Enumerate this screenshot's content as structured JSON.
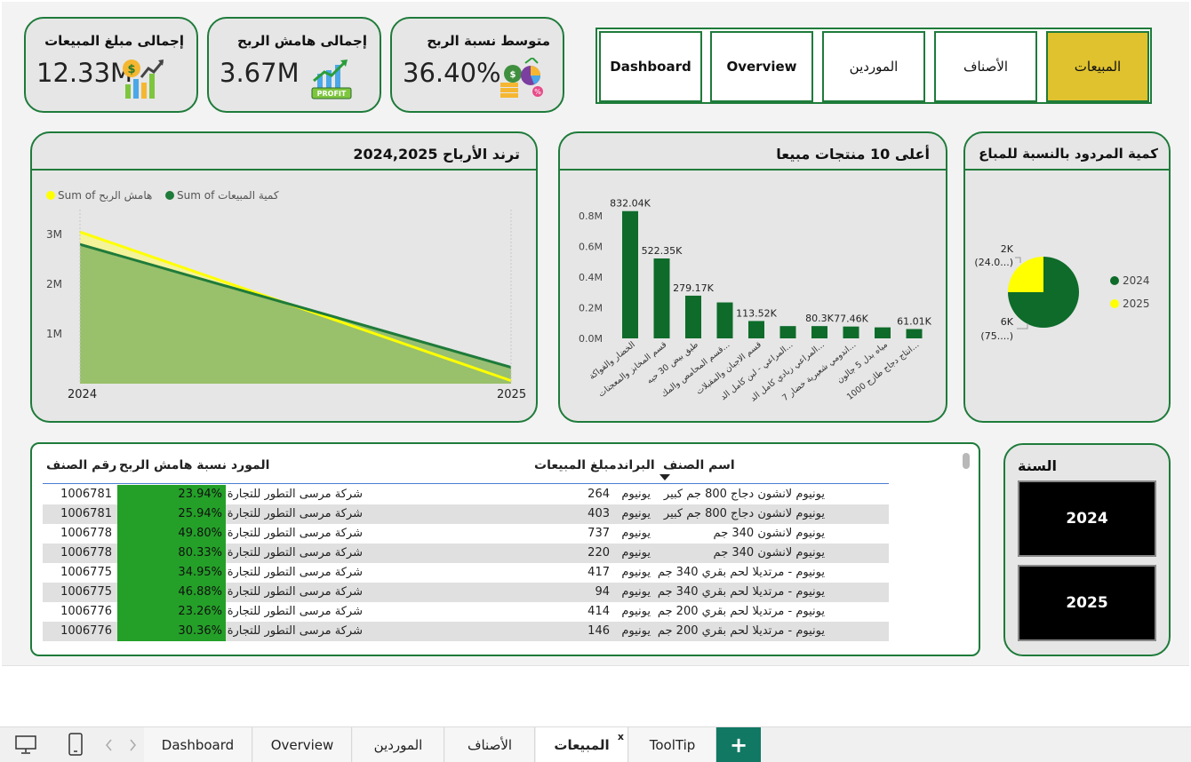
{
  "kpis": [
    {
      "title": "إجمالى مبلغ المبيعات",
      "value": "12.33M",
      "icon": "money-growth-icon"
    },
    {
      "title": "إجمالى هامش الربح",
      "value": "3.67M",
      "icon": "profit-growth-icon"
    },
    {
      "title": "متوسط نسبة الربح",
      "value": "36.40%",
      "icon": "money-bag-pie-icon"
    }
  ],
  "nav": [
    "Dashboard",
    "Overview",
    "الموردين",
    "الأصناف",
    "المبيعات"
  ],
  "nav_active": "المبيعات",
  "trend_panel": {
    "title": "ترند الأرباح 2024,2025"
  },
  "top10_panel": {
    "title": "أعلى 10 منتجات مبيعا"
  },
  "returns_panel": {
    "title": "كمية المردود بالنسبة للمباع"
  },
  "year_panel": {
    "title": "السنة",
    "years": [
      "2024",
      "2025"
    ]
  },
  "chart_data": [
    {
      "type": "area",
      "x": [
        "2024",
        "2025"
      ],
      "series": [
        {
          "name": "Sum of هامش الربح",
          "values": [
            3.05,
            0.06
          ],
          "color": "#ffff00"
        },
        {
          "name": "Sum of كمية المبيعات",
          "values": [
            2.8,
            0.33
          ],
          "color": "#1e7b3a"
        }
      ],
      "legend_items": [
        "Sum of هامش الربح",
        "Sum of كمية المبيعات"
      ],
      "yticks": [
        "3M",
        "2M",
        "1M"
      ],
      "ylim": [
        0,
        3.5
      ],
      "legend": "top-left"
    },
    {
      "type": "bar",
      "categories": [
        "الخضار والفواكة",
        "قسم المخابز والمعجنات",
        "طبق بيض 30 حبه",
        "قسم المحامص والمك...",
        "قسم الاجبان والمقبلات",
        "المراعي - لبن كامل الد...",
        "المراعي زبادي كامل الد...",
        "اندومي شعيرية خضار 7...",
        "مياه بدل 5 جالون",
        "انتاج دجاج طازج 1000..."
      ],
      "values": [
        832.04,
        522.35,
        279.17,
        235.0,
        113.52,
        80.3,
        80.3,
        77.46,
        72.0,
        61.01
      ],
      "data_labels": [
        "832.04K",
        "522.35K",
        "279.17K",
        "",
        "113.52K",
        "",
        "80.3K",
        "77.46K",
        "",
        "61.01K"
      ],
      "yticks": [
        "0.8M",
        "0.6M",
        "0.4M",
        "0.2M",
        "0.0M"
      ],
      "ylim": [
        0,
        900
      ],
      "color": "#0e6b2a"
    },
    {
      "type": "pie",
      "slices": [
        {
          "label": "2024",
          "value": 6,
          "display": "6K",
          "pct": "(75....)",
          "color": "#0e6b2a"
        },
        {
          "label": "2025",
          "value": 2,
          "display": "2K",
          "pct": "(24.0...)",
          "color": "#ffff00"
        }
      ],
      "legend": "right"
    }
  ],
  "table": {
    "headers": {
      "code": "رقم الصنف",
      "margin": "نسبة هامش الربح",
      "supplier": "المورد",
      "amount": "مبلغ المبيعات",
      "brand": "البراند",
      "name": "اسم الصنف"
    },
    "rows": [
      {
        "code": "1006781",
        "margin": "23.94%",
        "supplier": "شركة مرسى التطور للتجارة",
        "amount": "264",
        "brand": "يونيوم",
        "name": "يونيوم لانشون دجاج 800 جم كبير"
      },
      {
        "code": "1006781",
        "margin": "25.94%",
        "supplier": "شركة مرسى التطور للتجارة",
        "amount": "403",
        "brand": "يونيوم",
        "name": "يونيوم لانشون دجاج 800 جم كبير"
      },
      {
        "code": "1006778",
        "margin": "49.80%",
        "supplier": "شركة مرسى التطور للتجارة",
        "amount": "737",
        "brand": "يونيوم",
        "name": "يونيوم لانشون 340 جم"
      },
      {
        "code": "1006778",
        "margin": "80.33%",
        "supplier": "شركة مرسى التطور للتجارة",
        "amount": "220",
        "brand": "يونيوم",
        "name": "يونيوم لانشون 340 جم"
      },
      {
        "code": "1006775",
        "margin": "34.95%",
        "supplier": "شركة مرسى التطور للتجارة",
        "amount": "417",
        "brand": "يونيوم",
        "name": "يونيوم - مرتديلا لحم بقري 340 جم"
      },
      {
        "code": "1006775",
        "margin": "46.88%",
        "supplier": "شركة مرسى التطور للتجارة",
        "amount": "94",
        "brand": "يونيوم",
        "name": "يونيوم - مرتديلا لحم بقري 340 جم"
      },
      {
        "code": "1006776",
        "margin": "23.26%",
        "supplier": "شركة مرسى التطور للتجارة",
        "amount": "414",
        "brand": "يونيوم",
        "name": "يونيوم - مرتديلا لحم بقري 200 جم"
      },
      {
        "code": "1006776",
        "margin": "30.36%",
        "supplier": "شركة مرسى التطور للتجارة",
        "amount": "146",
        "brand": "يونيوم",
        "name": "يونيوم - مرتديلا لحم بقري 200 جم"
      }
    ]
  },
  "tabs": [
    "Dashboard",
    "Overview",
    "الموردين",
    "الأصناف",
    "المبيعات",
    "ToolTip"
  ],
  "tab_active": "المبيعات",
  "tab_close": "x",
  "add_tab": "+",
  "colors": {
    "accent_green": "#1e7b3a",
    "active_nav": "#dfc22e",
    "bar_green": "#0e6b2a",
    "yellow": "#ffff00",
    "add_tab": "#117864"
  }
}
